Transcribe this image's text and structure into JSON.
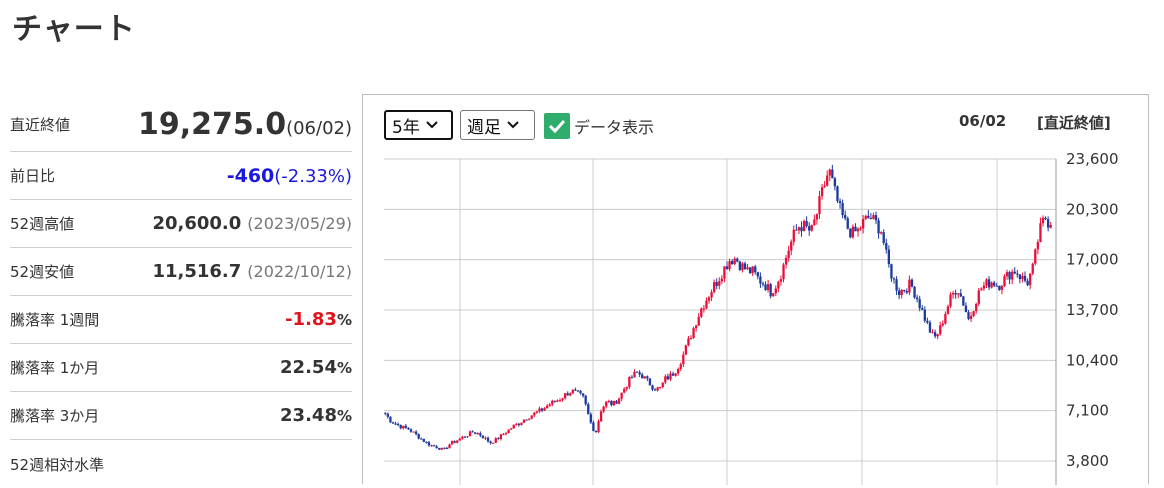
{
  "page": {
    "title": "チャート"
  },
  "stats": {
    "latest": {
      "label": "直近終値",
      "value": "19,275.0",
      "date": "(06/02)"
    },
    "change": {
      "label": "前日比",
      "value": "-460",
      "pct": "(-2.33%)"
    },
    "high52": {
      "label": "52週高値",
      "value": "20,600.0",
      "date": "(2023/05/29)"
    },
    "low52": {
      "label": "52週安値",
      "value": "11,516.7",
      "date": "(2022/10/12)"
    },
    "rate1w": {
      "label": "騰落率 1週間",
      "value": "-1.83",
      "unit": "%"
    },
    "rate1m": {
      "label": "騰落率 1か月",
      "value": "22.54",
      "unit": "%"
    },
    "rate3m": {
      "label": "騰落率 3か月",
      "value": "23.48",
      "unit": "%"
    },
    "rel52": {
      "label": "52週相対水準"
    }
  },
  "controls": {
    "period": {
      "value": "5年"
    },
    "interval": {
      "value": "週足"
    },
    "show_data": {
      "label": "データ表示",
      "checked": true
    }
  },
  "chart_header": {
    "date": "06/02",
    "tag": "[直近終値]"
  },
  "colors": {
    "up": "#e8103a",
    "down": "#1a3a9e",
    "grid": "#cccccc",
    "check": "#2ead6d"
  },
  "chart_data": {
    "type": "candlestick",
    "yticks": [
      "23,600",
      "20,300",
      "17,000",
      "13,700",
      "10,400",
      "7,100",
      "3,800"
    ],
    "ylim": [
      3800,
      23600
    ],
    "grid": true,
    "close_path": [
      6900,
      6400,
      6200,
      6000,
      5900,
      5600,
      5300,
      5000,
      4800,
      4700,
      4500,
      4900,
      5100,
      5300,
      5500,
      5700,
      5600,
      5300,
      5000,
      5200,
      5500,
      5800,
      6100,
      6300,
      6600,
      6800,
      7000,
      7200,
      7500,
      7700,
      7900,
      8200,
      8400,
      8200,
      7900,
      6500,
      5600,
      7200,
      7700,
      7500,
      7900,
      8600,
      9200,
      9600,
      9400,
      9000,
      8600,
      8500,
      9200,
      9400,
      9900,
      10700,
      11700,
      12700,
      13700,
      14400,
      15100,
      15700,
      16400,
      17000,
      17100,
      16600,
      16300,
      16200,
      15700,
      15400,
      14900,
      15400,
      16300,
      17600,
      18600,
      19300,
      19100,
      18800,
      20100,
      21600,
      22900,
      21400,
      20100,
      19200,
      18700,
      18900,
      19500,
      19800,
      19400,
      18900,
      16900,
      15700,
      14900,
      15100,
      15400,
      14600,
      13600,
      12600,
      11800,
      12400,
      13600,
      14600,
      15200,
      14200,
      13000,
      14200,
      15100,
      15400,
      15600,
      15300,
      15700,
      16100,
      16300,
      15800,
      15500,
      16500,
      18700,
      19800,
      19275
    ]
  }
}
